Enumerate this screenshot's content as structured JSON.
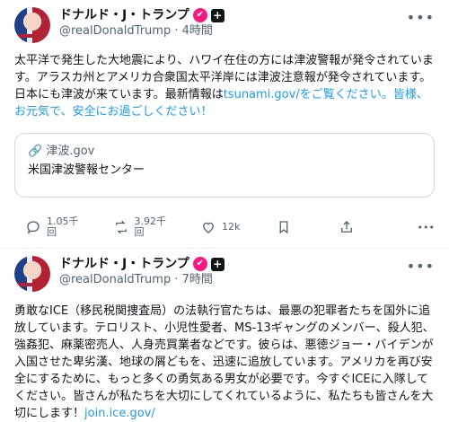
{
  "posts": [
    {
      "author": "ドナルド・J・トランプ",
      "handle_time": "@realDonaldTrump · 4時間",
      "badge": "✔",
      "plus": "+",
      "text_main": "太平洋で発生した大地震により、ハワイ在住の方には津波警報が発令されています。アラスカ州とアメリカ合衆国太平洋岸には津波注意報が発令されています。日本にも津波が来ています。最新情報は",
      "text_link": "tsunami.gov/をご覧ください。皆様、お元気で、安全にお過ごしください！",
      "card": {
        "domain": "津波.gov",
        "title": "米国津波警報センター"
      },
      "actions": {
        "replies": "1.05千\n回",
        "reposts": "3.92千\n回",
        "likes": "12k"
      }
    },
    {
      "author": "ドナルド・J・トランプ",
      "handle_time": "@realDonaldTrump · 7時間",
      "badge": "✔",
      "plus": "+",
      "text_main": "勇敢なICE（移民税関捜査局）の法執行官たちは、最悪の犯罪者たちを国外に追放しています。テロリスト、小児性愛者、MS-13ギャングのメンバー、殺人犯、強姦犯、麻薬密売人、人身売買業者などです。彼らは、悪徳ジョー・バイデンが入国させた卑劣漢、地球の屑どもを、迅速に追放しています。アメリカを再び安全にするために、もっと多くの勇気ある男女が必要です。今すぐICEに入隊してください。皆さんが私たちを大切にしてくれているように、私たちも皆さんを大切にします！",
      "text_link": "join.ice.gov/"
    }
  ]
}
